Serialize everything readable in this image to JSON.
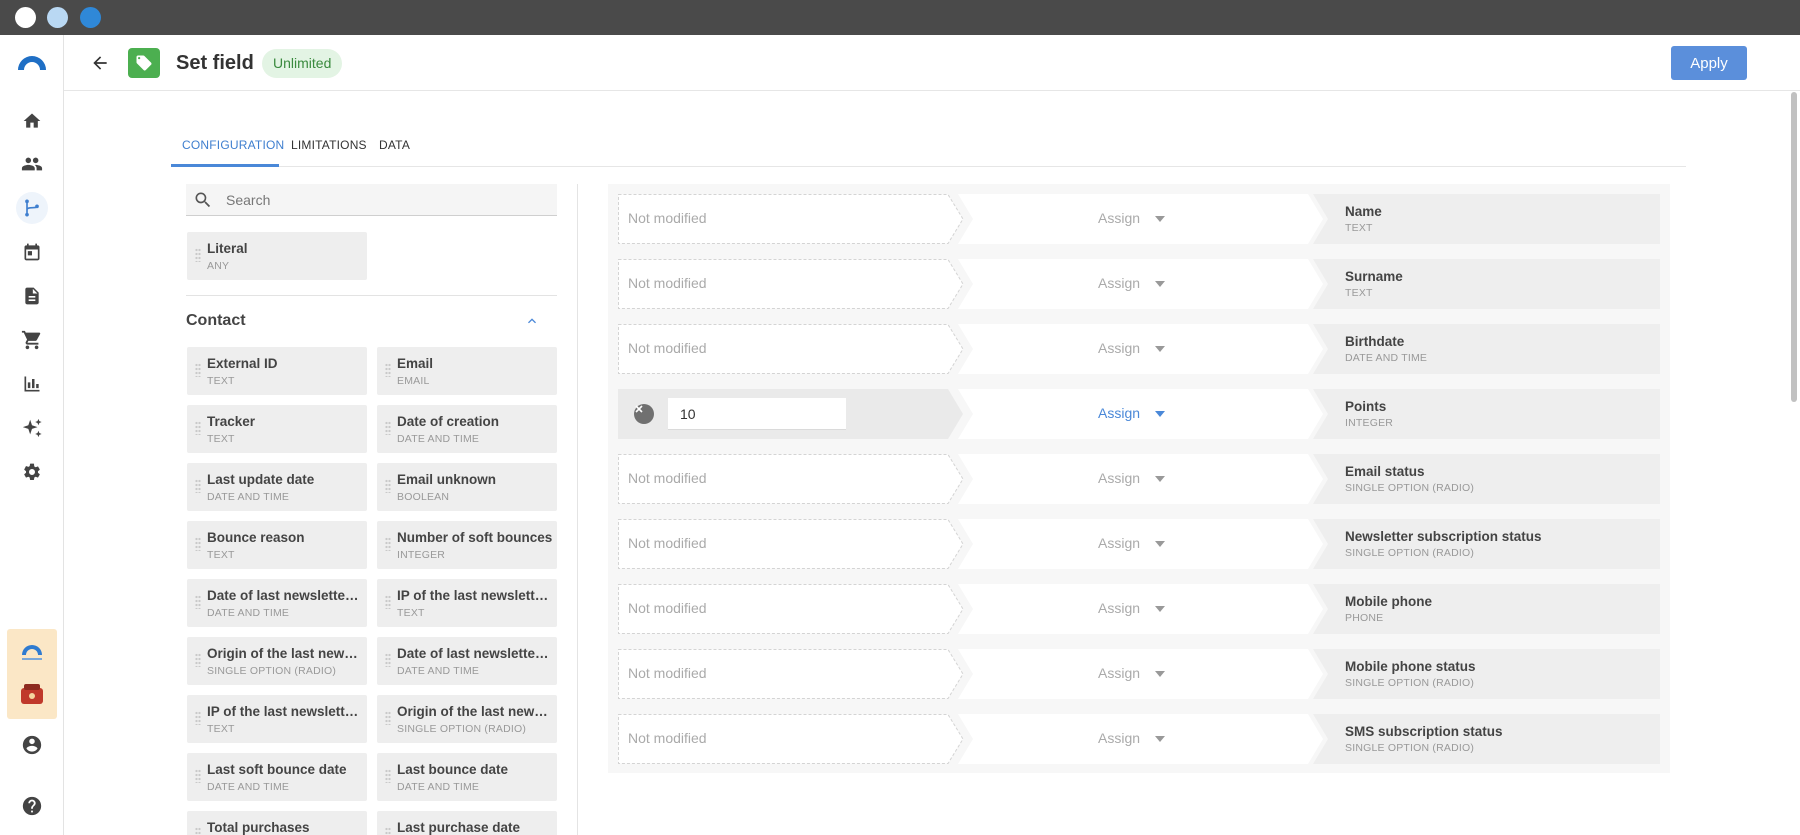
{
  "window": {
    "controls": [
      "close",
      "minimize",
      "maximize"
    ]
  },
  "rail": {
    "items": [
      {
        "name": "home-icon"
      },
      {
        "name": "contacts-icon"
      },
      {
        "name": "automation-icon",
        "active": true
      },
      {
        "name": "calendar-icon"
      },
      {
        "name": "document-icon"
      },
      {
        "name": "cart-icon"
      },
      {
        "name": "analytics-icon"
      },
      {
        "name": "sparkle-icon"
      },
      {
        "name": "settings-icon"
      }
    ],
    "bottom": [
      {
        "name": "account-icon"
      },
      {
        "name": "help-icon"
      }
    ]
  },
  "header": {
    "title": "Set field",
    "badge": "Unlimited",
    "apply_label": "Apply",
    "icon": "tag-icon"
  },
  "tabs": [
    {
      "label": "CONFIGURATION",
      "active": true
    },
    {
      "label": "LIMITATIONS"
    },
    {
      "label": "DATA"
    }
  ],
  "search": {
    "placeholder": "Search",
    "value": ""
  },
  "literal": {
    "name": "Literal",
    "type": "ANY"
  },
  "section": {
    "title": "Contact",
    "expanded": true
  },
  "fields": [
    {
      "name": "External ID",
      "type": "TEXT"
    },
    {
      "name": "Email",
      "type": "EMAIL"
    },
    {
      "name": "Tracker",
      "type": "TEXT"
    },
    {
      "name": "Date of creation",
      "type": "DATE AND TIME"
    },
    {
      "name": "Last update date",
      "type": "DATE AND TIME"
    },
    {
      "name": "Email unknown",
      "type": "BOOLEAN"
    },
    {
      "name": "Bounce reason",
      "type": "TEXT"
    },
    {
      "name": "Number of soft bounces",
      "type": "INTEGER"
    },
    {
      "name": "Date of last newsletter…",
      "type": "DATE AND TIME"
    },
    {
      "name": "IP of the last newslette…",
      "type": "TEXT"
    },
    {
      "name": "Origin of the last news…",
      "type": "SINGLE OPTION (RADIO)"
    },
    {
      "name": "Date of last newsletter…",
      "type": "DATE AND TIME"
    },
    {
      "name": "IP of the last newslette…",
      "type": "TEXT"
    },
    {
      "name": "Origin of the last news…",
      "type": "SINGLE OPTION (RADIO)"
    },
    {
      "name": "Last soft bounce date",
      "type": "DATE AND TIME"
    },
    {
      "name": "Last bounce date",
      "type": "DATE AND TIME"
    },
    {
      "name": "Total purchases",
      "type": ""
    },
    {
      "name": "Last purchase date",
      "type": ""
    }
  ],
  "mapping": {
    "placeholder": "Not modified",
    "operation": "Assign",
    "rows": [
      {
        "target": "Name",
        "type": "TEXT",
        "value": ""
      },
      {
        "target": "Surname",
        "type": "TEXT",
        "value": ""
      },
      {
        "target": "Birthdate",
        "type": "DATE AND TIME",
        "value": ""
      },
      {
        "target": "Points",
        "type": "INTEGER",
        "value": "10",
        "active": true
      },
      {
        "target": "Email status",
        "type": "SINGLE OPTION (RADIO)",
        "value": ""
      },
      {
        "target": "Newsletter subscription status",
        "type": "SINGLE OPTION (RADIO)",
        "value": ""
      },
      {
        "target": "Mobile phone",
        "type": "PHONE",
        "value": ""
      },
      {
        "target": "Mobile phone status",
        "type": "SINGLE OPTION (RADIO)",
        "value": ""
      },
      {
        "target": "SMS subscription status",
        "type": "SINGLE OPTION (RADIO)",
        "value": ""
      }
    ]
  },
  "colors": {
    "accent": "#4a88d8",
    "apply_button": "#5b8fdb",
    "badge_bg": "#e3f4e4",
    "badge_text": "#3a8a3e",
    "tag_tile": "#4caf50"
  }
}
